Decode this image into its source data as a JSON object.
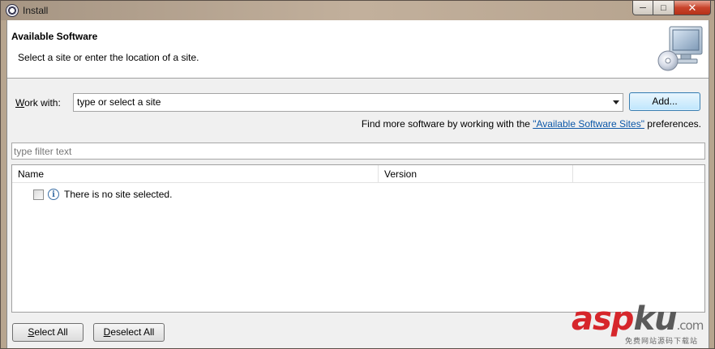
{
  "window": {
    "title": "Install"
  },
  "header": {
    "title": "Available Software",
    "description": "Select a site or enter the location of a site."
  },
  "workwith": {
    "label_mnemonic": "W",
    "label_rest": "ork with:",
    "combo_value": "type or select a site",
    "add_label": "Add..."
  },
  "findmore": {
    "prefix": "Find more software by working with the ",
    "link": "\"Available Software Sites\"",
    "suffix": " preferences."
  },
  "filter": {
    "placeholder": "type filter text"
  },
  "table": {
    "columns": [
      "Name",
      "Version",
      ""
    ],
    "rows": [
      {
        "checked": false,
        "icon": "info-icon",
        "text": "There is no site selected."
      }
    ]
  },
  "buttons": {
    "select_all_mnemonic": "S",
    "select_all_rest": "elect All",
    "deselect_all_mnemonic": "D",
    "deselect_all_rest": "eselect All"
  },
  "watermark": {
    "brand_a": "asp",
    "brand_b": "ku",
    "brand_c": ".com",
    "subtitle": "免费网站源码下载站"
  },
  "colors": {
    "link": "#0b57a8",
    "close_button": "#c8432b",
    "default_button_border": "#3c7fb1"
  }
}
